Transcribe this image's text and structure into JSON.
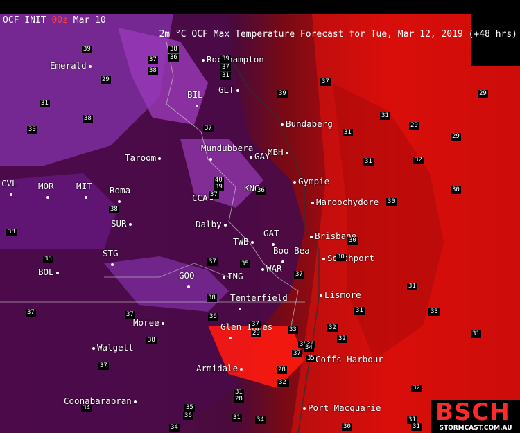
{
  "header": {
    "left_prefix": "OCF INIT ",
    "left_model": "00z",
    "left_suffix": " Mar 10",
    "title": "2m °C OCF Max Temperature Forecast for Tue, Mar 12, 2019 (+48 hrs)"
  },
  "cities": [
    {
      "name": "Rockhampton",
      "dot": "before"
    },
    {
      "name": "Emerald",
      "dot": "after"
    },
    {
      "name": "GLT",
      "dot": "after"
    },
    {
      "name": "BIL",
      "dot": "below"
    },
    {
      "name": "Bundaberg",
      "dot": "before"
    },
    {
      "name": "Mundubbera",
      "dot": "below"
    },
    {
      "name": "GAY",
      "dot": "before"
    },
    {
      "name": "MBH",
      "dot": "after"
    },
    {
      "name": "Taroom",
      "dot": "after"
    },
    {
      "name": "Gympie",
      "dot": "before"
    },
    {
      "name": "CVL",
      "dot": "below"
    },
    {
      "name": "MOR",
      "dot": "below"
    },
    {
      "name": "MIT",
      "dot": "below"
    },
    {
      "name": "Roma",
      "dot": "below"
    },
    {
      "name": "KNG",
      "dot": "after"
    },
    {
      "name": "CCA",
      "dot": "after"
    },
    {
      "name": "Maroochydore",
      "dot": "before"
    },
    {
      "name": "SUR",
      "dot": "after"
    },
    {
      "name": "Dalby",
      "dot": "after"
    },
    {
      "name": "GAT",
      "dot": "below"
    },
    {
      "name": "Brisbane",
      "dot": "before"
    },
    {
      "name": "TWB",
      "dot": "after"
    },
    {
      "name": "Boo Bea",
      "dot": "below"
    },
    {
      "name": "STG",
      "dot": "below"
    },
    {
      "name": "Southport",
      "dot": "before"
    },
    {
      "name": "BOL",
      "dot": "after"
    },
    {
      "name": "WAR",
      "dot": "before"
    },
    {
      "name": "GOO",
      "dot": "below"
    },
    {
      "name": "ING",
      "dot": "before"
    },
    {
      "name": "Lismore",
      "dot": "before"
    },
    {
      "name": "Tenterfield",
      "dot": "below"
    },
    {
      "name": "Moree",
      "dot": "after"
    },
    {
      "name": "Glen Innes",
      "dot": "below"
    },
    {
      "name": "Walgett",
      "dot": "before"
    },
    {
      "name": "Coffs Harbour",
      "dot": "before"
    },
    {
      "name": "Armidale",
      "dot": "after"
    },
    {
      "name": "Coonabarabran",
      "dot": "after"
    },
    {
      "name": "Port Macquarie",
      "dot": "before"
    }
  ],
  "temps": [
    "39",
    "37",
    "38",
    "36",
    "39",
    "37",
    "38",
    "31",
    "29",
    "39",
    "37",
    "31",
    "38",
    "29",
    "31",
    "30",
    "29",
    "31",
    "37",
    "29",
    "40",
    "39",
    "37",
    "36",
    "31",
    "32",
    "38",
    "30",
    "38",
    "30",
    "38",
    "30",
    "31",
    "37",
    "30",
    "37",
    "35",
    "37",
    "38",
    "37",
    "36",
    "31",
    "32",
    "33",
    "37",
    "38",
    "32",
    "35",
    "31",
    "37",
    "28",
    "29",
    "37",
    "36",
    "35",
    "34",
    "33",
    "32",
    "31",
    "36",
    "28",
    "32",
    "34",
    "31",
    "30",
    "31",
    "35",
    "34",
    "32",
    "34",
    "31",
    "33"
  ],
  "temperature_scale": {
    "low_color": "#4a0a48",
    "mid_color": "#7a2a9a",
    "high_color": "#ff1a10"
  },
  "logo": {
    "brand": "BSCH",
    "site": "STORMCAST.COM.AU"
  }
}
